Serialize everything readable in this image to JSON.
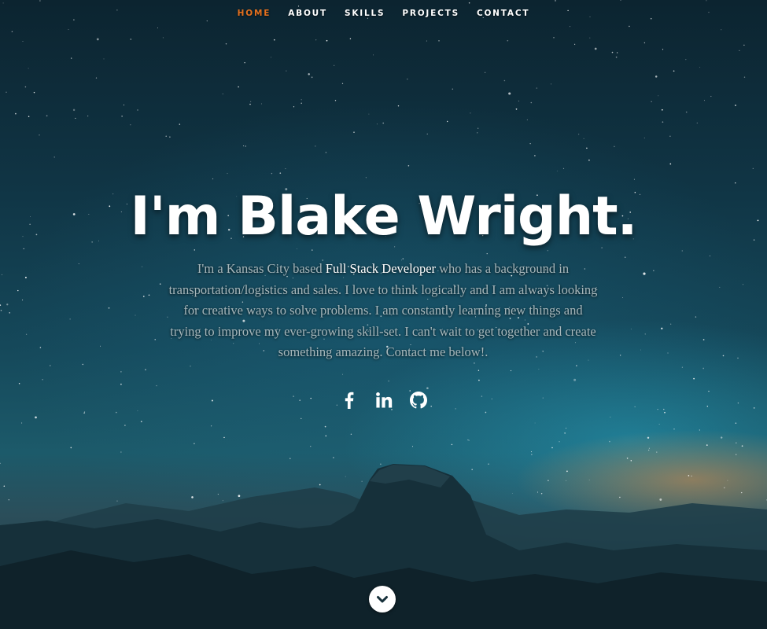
{
  "nav": {
    "items": [
      {
        "label": "HOME",
        "active": true
      },
      {
        "label": "ABOUT",
        "active": false
      },
      {
        "label": "SKILLS",
        "active": false
      },
      {
        "label": "PROJECTS",
        "active": false
      },
      {
        "label": "CONTACT",
        "active": false
      }
    ]
  },
  "hero": {
    "headline": "I'm Blake Wright.",
    "bio_intro": "I'm a Kansas City based ",
    "bio_highlight": "Full Stack Developer",
    "bio_rest": " who has a background in transportation/logistics and sales. I love to think logically and I am always looking for creative ways to solve problems. I am constantly learning new things and trying to improve my ever-growing skill-set. I can't wait to get together and create something amazing. Contact me below!."
  },
  "social": [
    {
      "icon": "facebook-icon"
    },
    {
      "icon": "linkedin-icon"
    },
    {
      "icon": "github-icon"
    }
  ],
  "scroll": {
    "icon": "chevron-down-icon"
  },
  "colors": {
    "accent": "#e4701e",
    "text": "#ffffff",
    "muted_text": "#a7b7bb"
  }
}
